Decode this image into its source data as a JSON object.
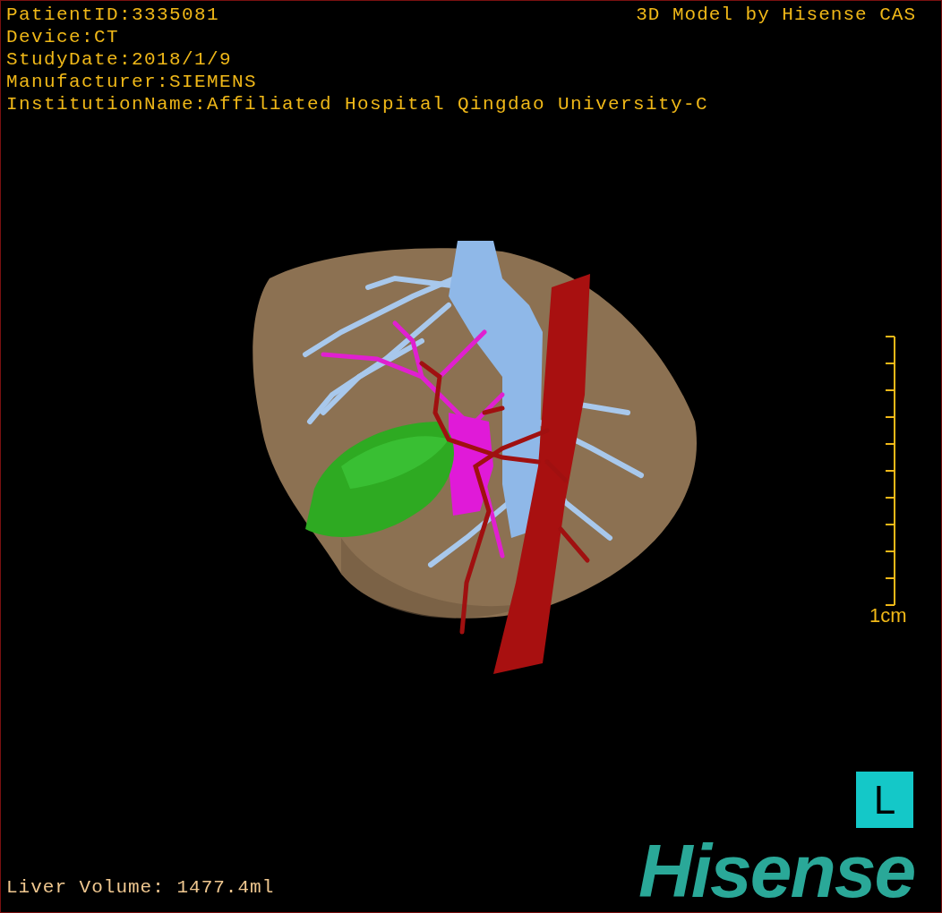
{
  "info_lines": [
    "PatientID:3335081",
    "Device:CT",
    "StudyDate:2018/1/9",
    "Manufacturer:SIEMENS",
    "InstitutionName:Affiliated Hospital Qingdao University-C"
  ],
  "model_credit": "3D Model by Hisense CAS",
  "scale_bar": {
    "label": "1cm"
  },
  "orientation_marker": "L",
  "liver_volume": "Liver Volume: 1477.4ml",
  "logo": "Hisense"
}
